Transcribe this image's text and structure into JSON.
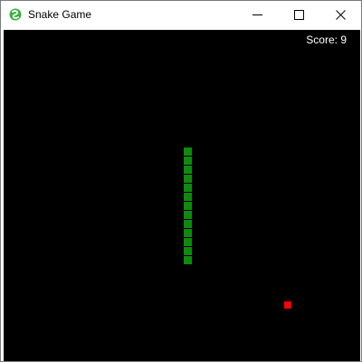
{
  "window": {
    "title": "Snake Game",
    "app_icon": "snake-app-icon",
    "controls": [
      "minimize",
      "maximize",
      "close"
    ]
  },
  "game": {
    "score_text": "Score: 9",
    "background_color": "#000000",
    "snake_color": "#0e8a0e",
    "food_color": "#ff0000",
    "snake_length": 13,
    "snake_direction": "vertical"
  }
}
